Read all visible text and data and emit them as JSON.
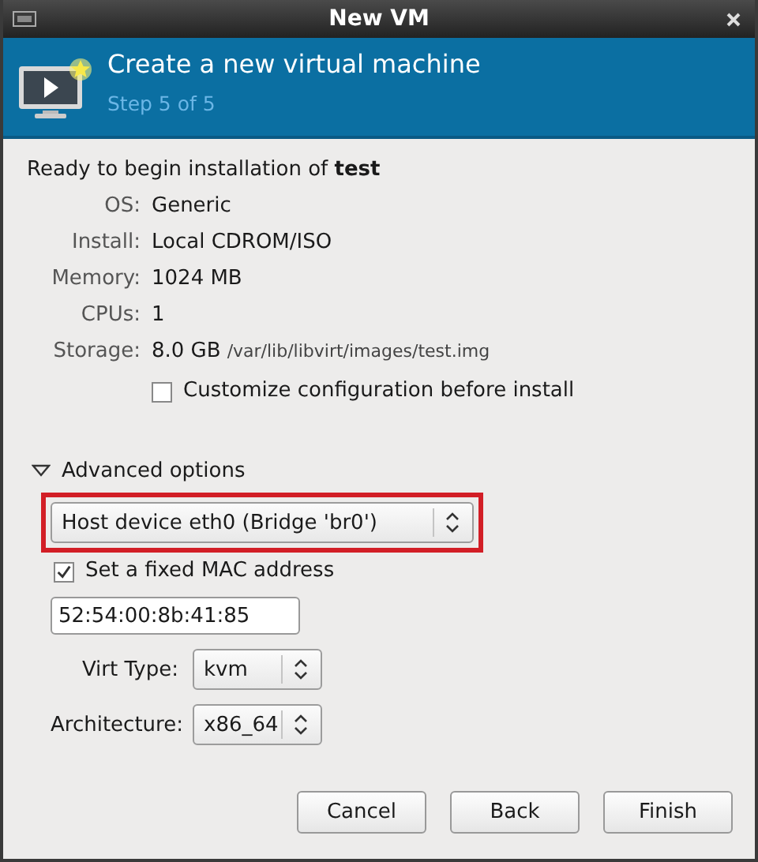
{
  "window": {
    "title": "New VM"
  },
  "header": {
    "title": "Create a new virtual machine",
    "subtitle": "Step 5 of 5"
  },
  "summary": {
    "heading": "Ready to begin installation of **test**",
    "rows": [
      {
        "label": "OS:",
        "value": "Generic"
      },
      {
        "label": "Install:",
        "value": "Local CDROM/ISO"
      },
      {
        "label": "Memory:",
        "value": "1024 MB"
      },
      {
        "label": "CPUs:",
        "value": "1"
      },
      {
        "label": "Storage:",
        "value": "8.0 GB",
        "detail": "/var/lib/libvirt/images/test.img"
      }
    ]
  },
  "customize": {
    "label": "Customize configuration before install",
    "checked": false
  },
  "advanced": {
    "label": "Advanced options",
    "expanded": true,
    "network": {
      "value": "Host device eth0 (Bridge 'br0')",
      "highlighted": true
    },
    "fixed_mac": {
      "label": "Set a fixed MAC address",
      "checked": true
    },
    "mac": {
      "value": "52:54:00:8b:41:85"
    },
    "fields": [
      {
        "label": "Virt Type:",
        "value": "kvm"
      },
      {
        "label": "Architecture:",
        "value": "x86_64"
      }
    ]
  },
  "buttons": [
    {
      "label": "Cancel"
    },
    {
      "label": "Back"
    },
    {
      "label": "Finish"
    }
  ]
}
